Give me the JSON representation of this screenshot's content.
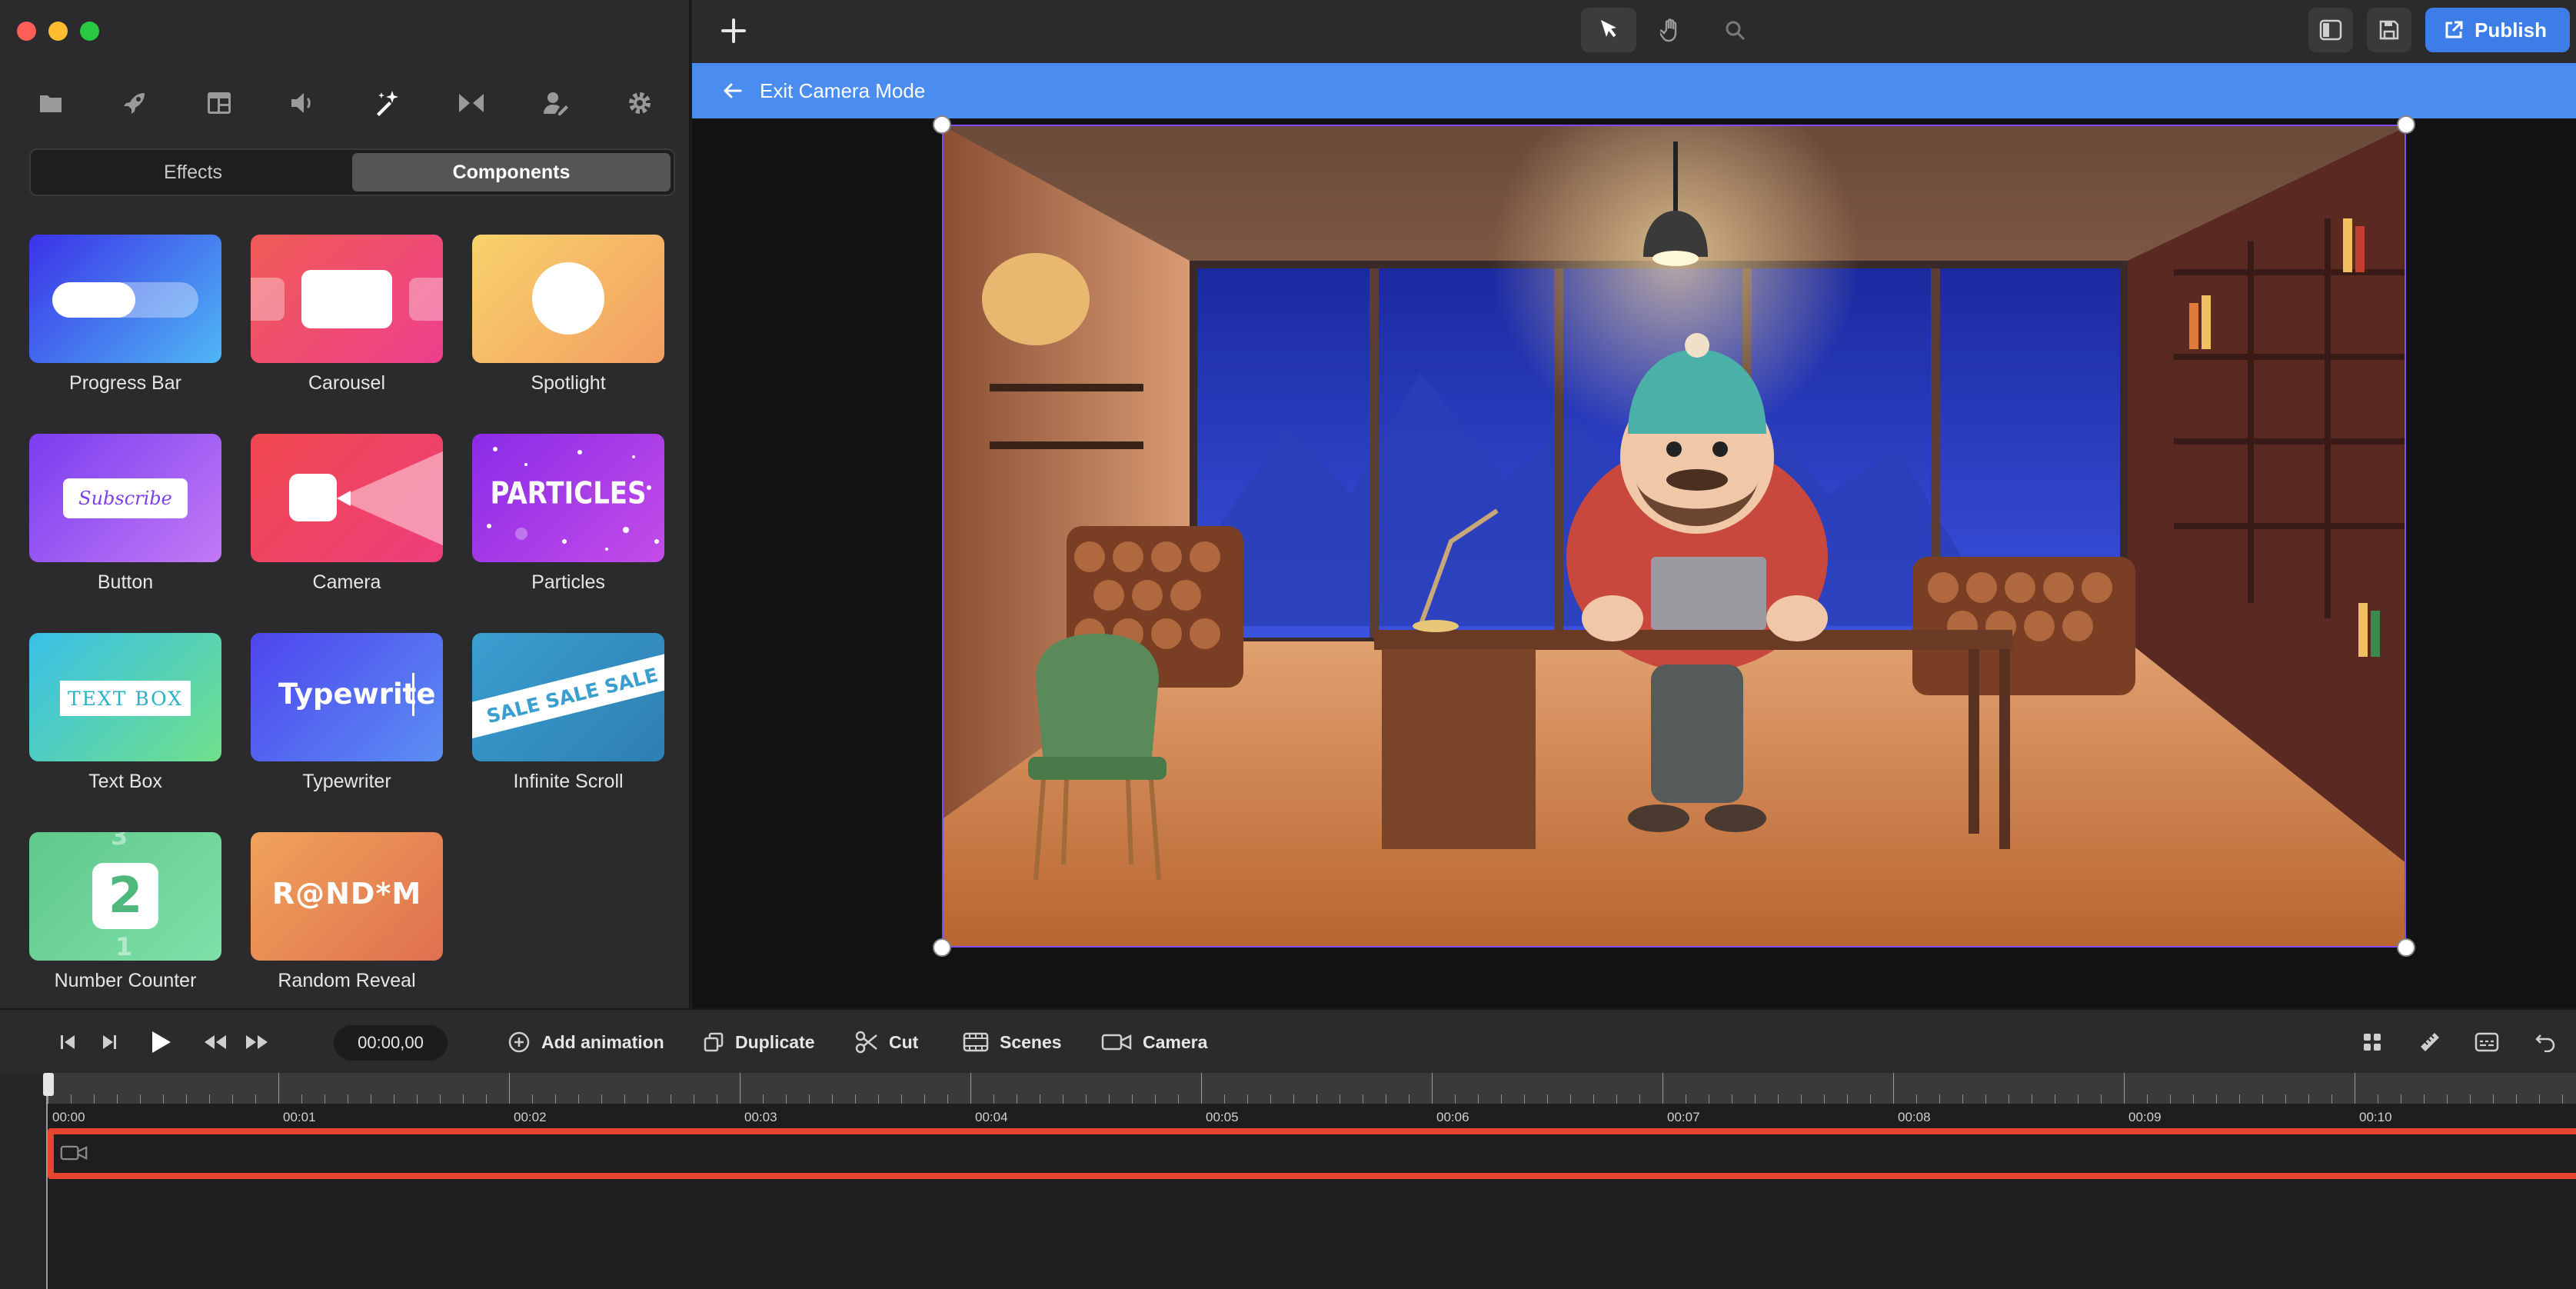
{
  "sidebar": {
    "tabs": [
      {
        "icon": "folder-icon"
      },
      {
        "icon": "rocket-icon"
      },
      {
        "icon": "layout-icon"
      },
      {
        "icon": "speaker-icon"
      },
      {
        "icon": "magic-wand-icon"
      },
      {
        "icon": "transition-icon"
      },
      {
        "icon": "user-edit-icon"
      },
      {
        "icon": "gear-icon"
      }
    ],
    "segments": {
      "effects": "Effects",
      "components": "Components"
    },
    "components": [
      {
        "label": "Progress Bar"
      },
      {
        "label": "Carousel"
      },
      {
        "label": "Spotlight"
      },
      {
        "label": "Button",
        "thumb_text": "Subscribe"
      },
      {
        "label": "Camera"
      },
      {
        "label": "Particles",
        "thumb_text": "PARTICLES"
      },
      {
        "label": "Text Box",
        "thumb_text": "TEXT BOX"
      },
      {
        "label": "Typewriter",
        "thumb_text": "Typewrite"
      },
      {
        "label": "Infinite Scroll",
        "thumb_text": "SALE SALE SALE"
      },
      {
        "label": "Number Counter",
        "thumb_text": "2",
        "thumb_top": "3",
        "thumb_bottom": "1"
      },
      {
        "label": "Random Reveal",
        "thumb_text": "R@ND*M"
      }
    ]
  },
  "topbar": {
    "publish": "Publish"
  },
  "camera_banner": {
    "label": "Exit Camera Mode"
  },
  "controls": {
    "time": "00:00,00",
    "add_animation": "Add animation",
    "duplicate": "Duplicate",
    "cut": "Cut",
    "scenes": "Scenes",
    "camera": "Camera"
  },
  "timeline": {
    "ticks": [
      "00:00",
      "00:01",
      "00:02",
      "00:03",
      "00:04",
      "00:05",
      "00:06",
      "00:07",
      "00:08",
      "00:09",
      "00:10"
    ]
  }
}
